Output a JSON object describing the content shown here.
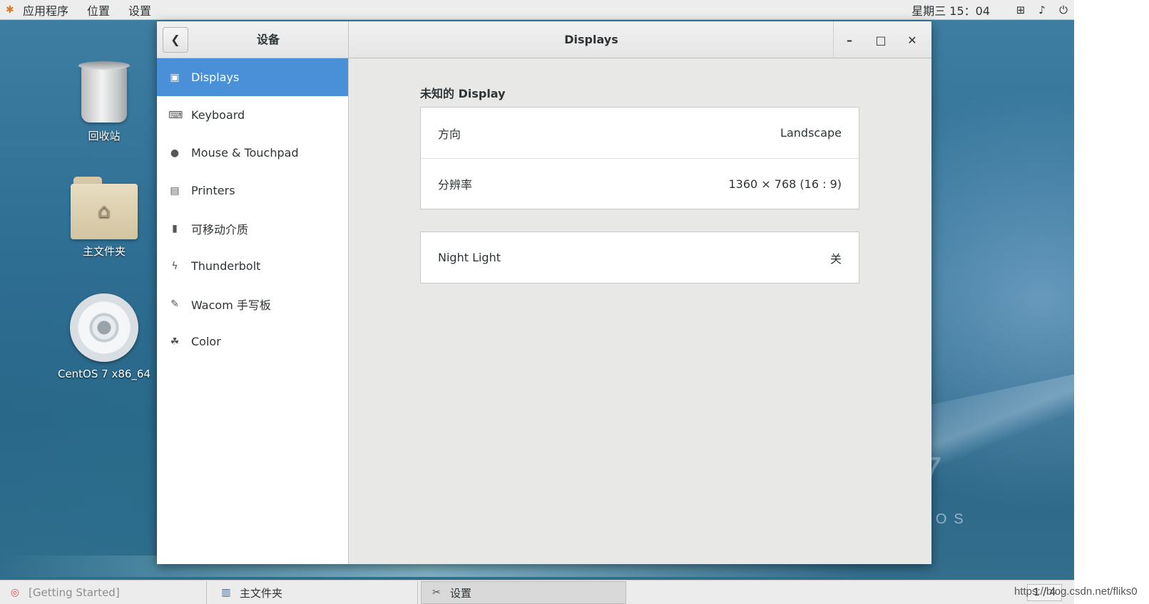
{
  "topbar": {
    "menu": [
      "应用程序",
      "位置",
      "设置"
    ],
    "clock": "星期三 15：04"
  },
  "desktop": {
    "icons": [
      {
        "label": "回收站",
        "icon": "trash-icon"
      },
      {
        "label": "主文件夹",
        "icon": "home-folder-icon"
      },
      {
        "label": "CentOS 7 x86_64",
        "icon": "optical-disc-icon"
      }
    ]
  },
  "window": {
    "sidebar_title": "设备",
    "title": "Displays",
    "sidebar": [
      {
        "label": "Displays",
        "icon": "display-icon",
        "selected": true
      },
      {
        "label": "Keyboard",
        "icon": "keyboard-icon"
      },
      {
        "label": "Mouse & Touchpad",
        "icon": "mouse-icon"
      },
      {
        "label": "Printers",
        "icon": "printer-icon"
      },
      {
        "label": "可移动介质",
        "icon": "usb-drive-icon"
      },
      {
        "label": "Thunderbolt",
        "icon": "thunderbolt-icon"
      },
      {
        "label": "Wacom 手写板",
        "icon": "tablet-icon"
      },
      {
        "label": "Color",
        "icon": "color-icon"
      }
    ],
    "content": {
      "section_title": "未知的  Display",
      "display_panel": [
        {
          "label": "方向",
          "value": "Landscape"
        },
        {
          "label": "分辨率",
          "value": "1360 × 768 (16 : 9)"
        }
      ],
      "night_light": {
        "label": "Night Light",
        "value": "关"
      }
    }
  },
  "taskbar": {
    "tasks": [
      {
        "label": "[Getting Started]",
        "icon": "help-lifebuoy-icon"
      },
      {
        "label": "主文件夹",
        "icon": "file-manager-icon"
      },
      {
        "label": "设置",
        "icon": "settings-tools-icon",
        "active": true
      }
    ],
    "pager": "1 / 4"
  },
  "watermark": "https://blog.csdn.net/fliks0"
}
